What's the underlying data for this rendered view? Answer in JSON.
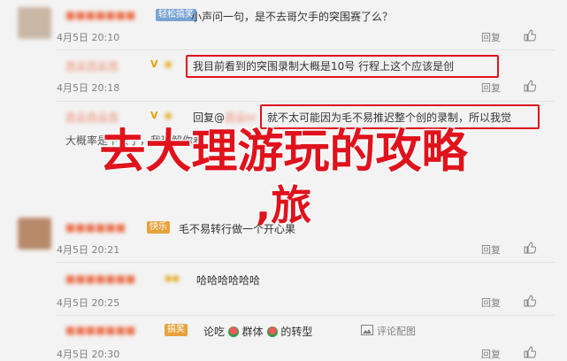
{
  "comments": [
    {
      "user": "",
      "badge": "轻松搞笑",
      "text": "小声问一句，是不去哥欠手的突围赛了么？",
      "date": "4月5日 20:10",
      "reply": "回复"
    },
    {
      "user": "吕云ɪʏ",
      "vip": "V",
      "text": "我目前看到的突围录制大概是10号 行程上这个应该是创",
      "date": "4月5日 20:18",
      "reply": "回复"
    },
    {
      "user": "吕云ɪʏ",
      "vip": "V",
      "reply_prefix": "回复@",
      "text": "就不太可能因为毛不易推迟整个创的录制，所以我觉",
      "date": "",
      "reply": "回复"
    },
    {
      "user": "",
      "text": "大概率是下去了，我理解你看",
      "date": "",
      "reply": ""
    },
    {
      "user": "",
      "badge": "快乐",
      "text": "毛不易转行做一个开心果",
      "date": "4月5日 20:21",
      "reply": "回复"
    },
    {
      "user": "",
      "text": "哈哈哈哈哈哈",
      "date": "4月5日 20:25",
      "reply": "回复"
    },
    {
      "user": "",
      "badge": "搞笑",
      "text_parts": [
        "论吃",
        "群体",
        "的转型"
      ],
      "reply_link": "评论配图",
      "date": "4月5日 20:30",
      "reply": "回复"
    }
  ],
  "overlay": {
    "line1": "去大理游玩的攻略",
    "line2": ",旅"
  },
  "colors": {
    "highlight": "#e0121c",
    "name": "#eb7350",
    "meta": "#808080"
  }
}
